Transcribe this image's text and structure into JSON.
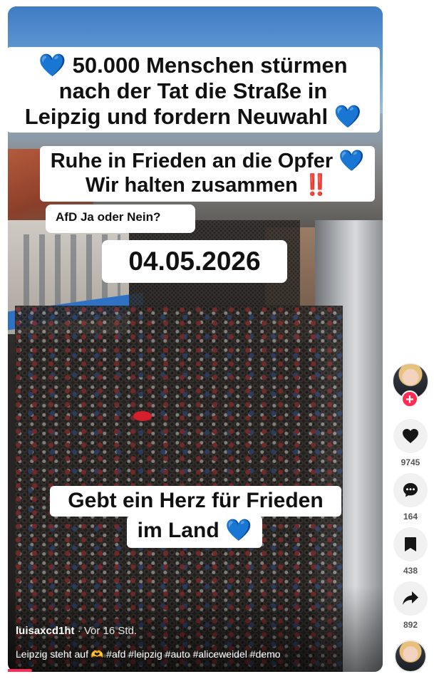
{
  "captions": {
    "line1_icon": "💙",
    "line1": "50.000 Menschen stürmen",
    "line2": "nach der Tat die Straße in",
    "line3": "Leipzig und fordern Neuwahl",
    "line3_icon": "💙",
    "line4": "Ruhe in Frieden an die Opfer",
    "line4_icon": "💙",
    "line5": "Wir halten zusammen",
    "line5_icon": "‼️",
    "question": "AfD Ja oder Nein?",
    "date": "04.05.2026",
    "bottom1": "Gebt ein Herz für Frieden",
    "bottom2": "im Land",
    "bottom2_icon": "💙"
  },
  "video": {
    "author": "luisaxcd1ht",
    "separator": "·",
    "time": "Vor 16 Std.",
    "description": "Leipzig steht auf 🫶 #afd #leipzig #auto #aliceweidel #demo"
  },
  "actions": {
    "likes": "9745",
    "comments": "164",
    "saves": "438",
    "shares": "892",
    "follow_symbol": "+"
  },
  "colors": {
    "accent": "#fe2c55",
    "heart_blue": "#1a7be6",
    "action_bg": "#f1f1f2"
  }
}
